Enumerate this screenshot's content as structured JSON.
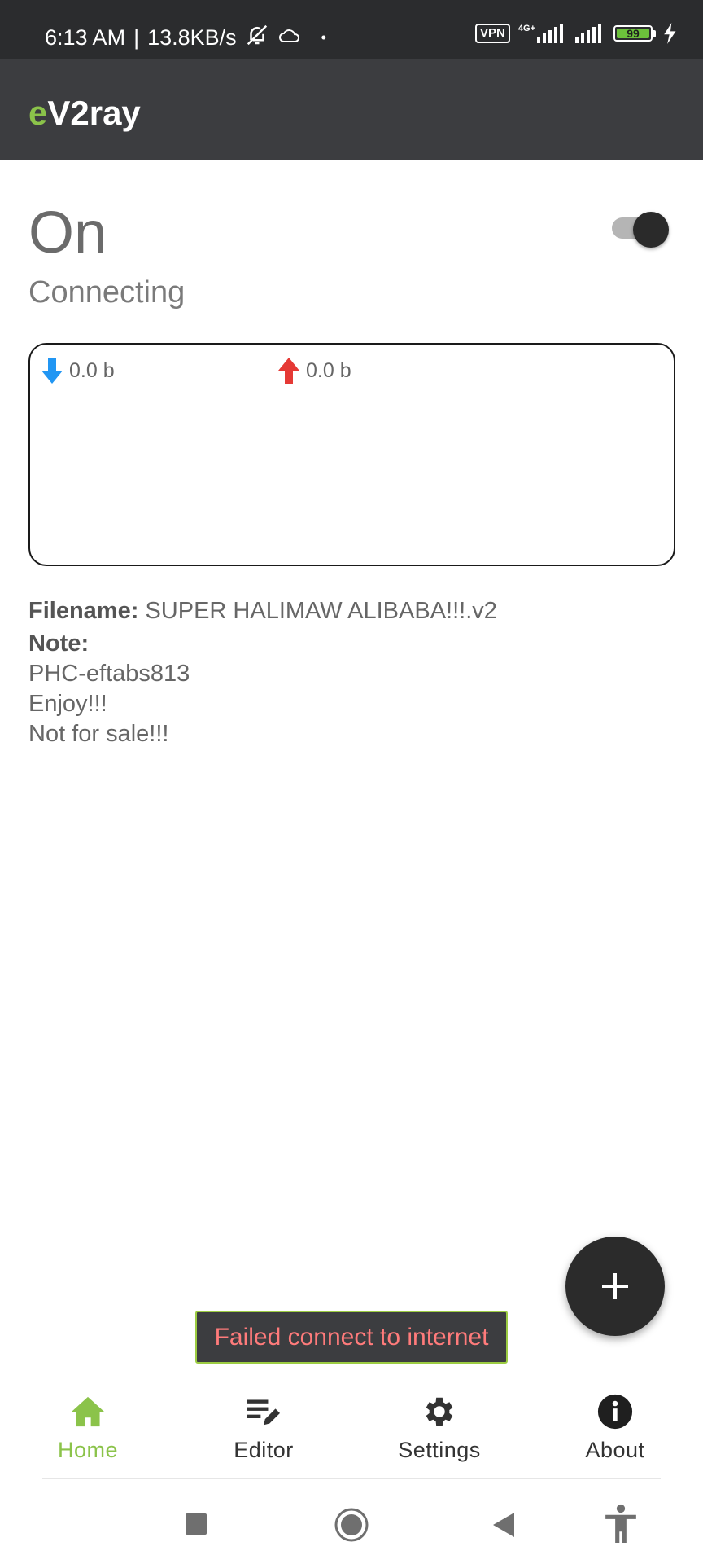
{
  "status_bar": {
    "time": "6:13 AM",
    "separator": "|",
    "speed": "13.8KB/s",
    "dot": "•",
    "vpn": "VPN",
    "network": "4G+",
    "battery": "99",
    "icons": [
      "mute-bell-icon",
      "cloud-icon",
      "signal-icon",
      "signal-icon",
      "charging-icon"
    ]
  },
  "app_bar": {
    "title_accent": "e",
    "title_rest": "V2ray"
  },
  "connection": {
    "state": "On",
    "status": "Connecting",
    "toggle_on": true
  },
  "traffic": {
    "download": "0.0 b",
    "upload": "0.0 b"
  },
  "info": {
    "filename_label": "Filename:",
    "filename_value": "SUPER HALIMAW ALIBABA!!!.v2",
    "note_label": "Note:",
    "note_lines": [
      "PHC-eftabs813",
      "Enjoy!!!",
      "Not for sale!!!"
    ]
  },
  "toast": {
    "message": "Failed connect to internet"
  },
  "bottom_nav": {
    "items": [
      {
        "label": "Home",
        "icon": "home-icon",
        "active": true
      },
      {
        "label": "Editor",
        "icon": "editor-icon",
        "active": false
      },
      {
        "label": "Settings",
        "icon": "gear-icon",
        "active": false
      },
      {
        "label": "About",
        "icon": "info-icon",
        "active": false
      }
    ]
  },
  "colors": {
    "accent": "#8bc34a",
    "app_bar": "#3c3d40",
    "download_arrow": "#2196f3",
    "upload_arrow": "#e53935",
    "toast_text": "#ff7b7b"
  }
}
